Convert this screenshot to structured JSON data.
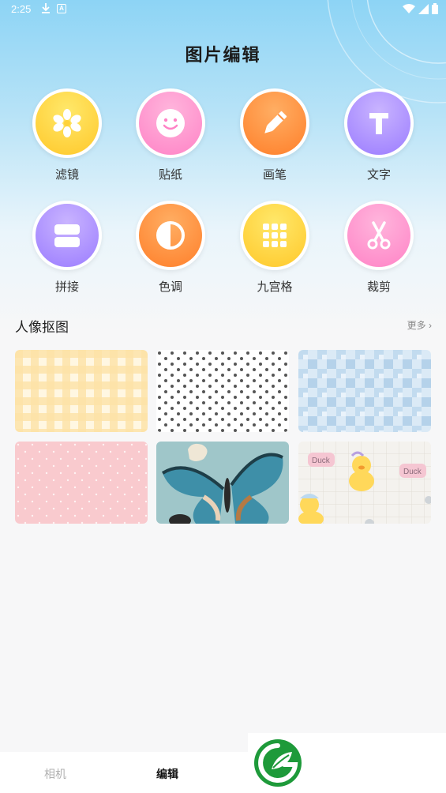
{
  "status": {
    "time": "2:25"
  },
  "title": "图片编辑",
  "tools": [
    {
      "label": "滤镜",
      "icon": "flower-icon"
    },
    {
      "label": "贴纸",
      "icon": "smiley-icon"
    },
    {
      "label": "画笔",
      "icon": "pencil-icon"
    },
    {
      "label": "文字",
      "icon": "text-t-icon"
    },
    {
      "label": "拼接",
      "icon": "collage-icon"
    },
    {
      "label": "色调",
      "icon": "contrast-icon"
    },
    {
      "label": "九宫格",
      "icon": "grid-icon"
    },
    {
      "label": "裁剪",
      "icon": "scissors-icon"
    }
  ],
  "section": {
    "title": "人像抠图",
    "more": "更多"
  },
  "backgrounds": [
    {
      "name": "yellow-plaid-thumb"
    },
    {
      "name": "dot-pattern-thumb"
    },
    {
      "name": "blue-mosaic-thumb"
    },
    {
      "name": "pink-dot-thumb"
    },
    {
      "name": "butterfly-thumb"
    },
    {
      "name": "duck-pattern-thumb"
    }
  ],
  "duck_words": [
    "Duck",
    "Duck"
  ],
  "tabs": {
    "camera": "相机",
    "edit": "编辑"
  },
  "colors": {
    "accent_yellow": "#ffc82a",
    "accent_pink": "#ff83c6",
    "accent_orange": "#ff7f2a",
    "accent_purple": "#9b7cff"
  }
}
